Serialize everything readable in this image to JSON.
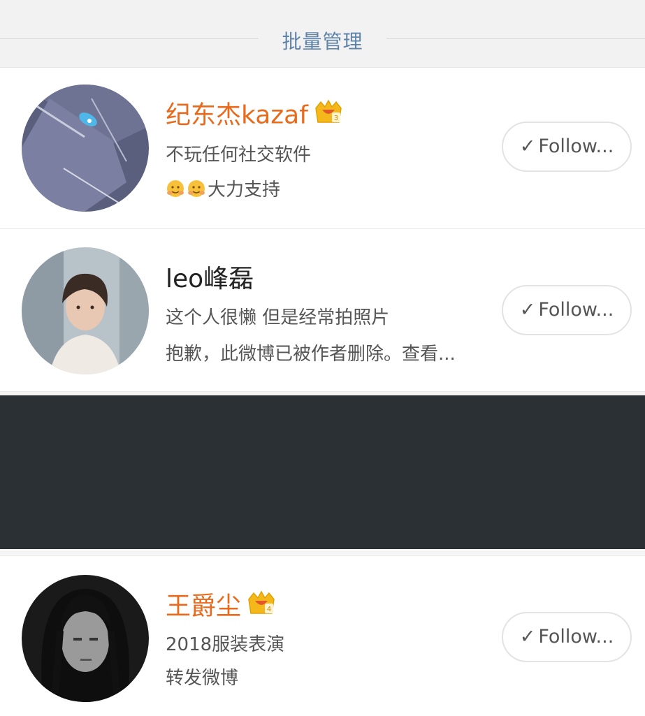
{
  "header": {
    "title": "批量管理"
  },
  "users": [
    {
      "name": "纪东杰kazaf",
      "vip": true,
      "crown_level": "3",
      "bio": "不玩任何社交软件",
      "latest": "大力支持",
      "latest_emojis": 2,
      "button": {
        "label": "Follow...",
        "icon": "check-icon"
      }
    },
    {
      "name": "leo峰磊",
      "vip": false,
      "bio": "这个人很懒 但是经常拍照片",
      "latest": "抱歉，此微博已被作者删除。查看...",
      "button": {
        "label": "Follow...",
        "icon": "check-icon"
      }
    },
    {
      "name": "王爵尘",
      "vip": true,
      "crown_level": "4",
      "bio": "2018服装表演",
      "latest": "转发微博",
      "button": {
        "label": "Follow...",
        "icon": "check-icon"
      }
    }
  ],
  "colors": {
    "vip_name": "#e86a1c",
    "header_title": "#5f83a9",
    "crown_gold": "#f5b81b",
    "redacted": "#2b3035"
  }
}
